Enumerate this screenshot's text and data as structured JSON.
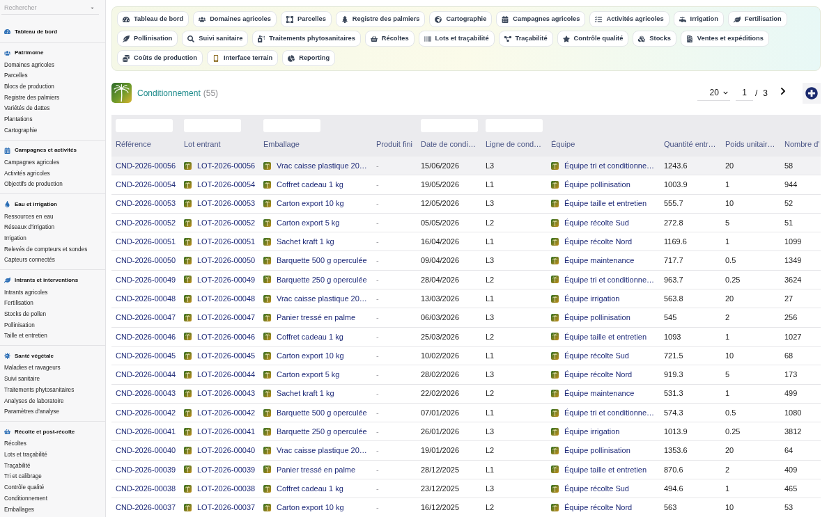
{
  "sidebar": {
    "search": {
      "placeholder": "Rechercher"
    },
    "sections": [
      {
        "title": "Tableau de bord"
      },
      {
        "title": "Patrimoine",
        "items": [
          "Domaines agricoles",
          "Parcelles",
          "Blocs de production",
          "Registre des palmiers",
          "Variétés de dattes",
          "Plantations",
          "Cartographie"
        ]
      },
      {
        "title": "Campagnes et activités",
        "items": [
          "Campagnes agricoles",
          "Activités agricoles",
          "Objectifs de production"
        ]
      },
      {
        "title": "Eau et irrigation",
        "items": [
          "Ressources en eau",
          "Réseaux d'irrigation",
          "Irrigation",
          "Relevés de compteurs et sondes",
          "Capteurs connectés"
        ]
      },
      {
        "title": "Intrants et interventions",
        "items": [
          "Intrants agricoles",
          "Fertilisation",
          "Stocks de pollen",
          "Pollinisation",
          "Taille et entretien"
        ]
      },
      {
        "title": "Santé végétale",
        "items": [
          "Maladies et ravageurs",
          "Suivi sanitaire",
          "Traitements phytosanitaires",
          "Analyses de laboratoire",
          "Paramètres d'analyse"
        ]
      },
      {
        "title": "Récolte et post-récolte",
        "items": [
          "Récoltes",
          "Lots et traçabilité",
          "Traçabilité",
          "Tri et calibrage",
          "Contrôle qualité",
          "Conditionnement",
          "Emballages"
        ]
      }
    ]
  },
  "tabs": [
    {
      "label": "Tableau de bord"
    },
    {
      "label": "Domaines agricoles"
    },
    {
      "label": "Parcelles"
    },
    {
      "label": "Registre des palmiers"
    },
    {
      "label": "Cartographie"
    },
    {
      "label": "Campagnes agricoles"
    },
    {
      "label": "Activités agricoles"
    },
    {
      "label": "Irrigation"
    },
    {
      "label": "Fertilisation"
    },
    {
      "label": "Pollinisation"
    },
    {
      "label": "Suivi sanitaire"
    },
    {
      "label": "Traitements phytosanitaires"
    },
    {
      "label": "Récoltes"
    },
    {
      "label": "Lots et traçabilité"
    },
    {
      "label": "Traçabilité"
    },
    {
      "label": "Contrôle qualité"
    },
    {
      "label": "Stocks"
    },
    {
      "label": "Ventes et expéditions"
    },
    {
      "label": "Coûts de production"
    },
    {
      "label": "Interface terrain"
    },
    {
      "label": "Reporting"
    }
  ],
  "page": {
    "title": "Conditionnement",
    "count": "(55)",
    "page_size": "20",
    "page": "1",
    "separator": "/",
    "total_pages": "3"
  },
  "table": {
    "columns": [
      {
        "label": "Référence",
        "kind": "link",
        "filter": true
      },
      {
        "label": "Lot entrant",
        "kind": "link_thumb",
        "filter": true
      },
      {
        "label": "Emballage",
        "kind": "link_thumb",
        "filter": true
      },
      {
        "label": "Produit fini",
        "kind": "muted",
        "filter": false
      },
      {
        "label": "Date de condi…",
        "kind": "text",
        "filter": true
      },
      {
        "label": "Ligne de cond…",
        "kind": "text",
        "filter": true
      },
      {
        "label": "Équipe",
        "kind": "link_thumb",
        "filter": false
      },
      {
        "label": "Quantité entr…",
        "kind": "text",
        "filter": false
      },
      {
        "label": "Poids unitair…",
        "kind": "text",
        "filter": false
      },
      {
        "label": "Nombre d'",
        "kind": "text",
        "filter": false
      }
    ],
    "rows": [
      {
        "highlighted": true,
        "cells": [
          "CND-2026-00056",
          "LOT-2026-00056",
          "Vrac caisse plastique 20…",
          "-",
          "15/06/2026",
          "L3",
          "Équipe tri et conditionne…",
          "1243.6",
          "20",
          "58"
        ]
      },
      {
        "highlighted": false,
        "cells": [
          "CND-2026-00054",
          "LOT-2026-00054",
          "Coffret cadeau 1 kg",
          "-",
          "19/05/2026",
          "L1",
          "Équipe pollinisation",
          "1003.9",
          "1",
          "944"
        ]
      },
      {
        "highlighted": false,
        "cells": [
          "CND-2026-00053",
          "LOT-2026-00053",
          "Carton export 10 kg",
          "-",
          "12/05/2026",
          "L3",
          "Équipe taille et entretien",
          "555.7",
          "10",
          "52"
        ]
      },
      {
        "highlighted": false,
        "cells": [
          "CND-2026-00052",
          "LOT-2026-00052",
          "Carton export 5 kg",
          "-",
          "05/05/2026",
          "L2",
          "Équipe récolte Sud",
          "272.8",
          "5",
          "51"
        ]
      },
      {
        "highlighted": false,
        "cells": [
          "CND-2026-00051",
          "LOT-2026-00051",
          "Sachet kraft 1 kg",
          "-",
          "16/04/2026",
          "L1",
          "Équipe récolte Nord",
          "1169.6",
          "1",
          "1099"
        ]
      },
      {
        "highlighted": false,
        "cells": [
          "CND-2026-00050",
          "LOT-2026-00050",
          "Barquette 500 g operculée",
          "-",
          "09/04/2026",
          "L3",
          "Équipe maintenance",
          "717.7",
          "0.5",
          "1349"
        ]
      },
      {
        "highlighted": false,
        "cells": [
          "CND-2026-00049",
          "LOT-2026-00049",
          "Barquette 250 g operculée",
          "-",
          "28/04/2026",
          "L2",
          "Équipe tri et conditionne…",
          "963.7",
          "0.25",
          "3624"
        ]
      },
      {
        "highlighted": false,
        "cells": [
          "CND-2026-00048",
          "LOT-2026-00048",
          "Vrac caisse plastique 20…",
          "-",
          "13/03/2026",
          "L1",
          "Équipe irrigation",
          "563.8",
          "20",
          "27"
        ]
      },
      {
        "highlighted": false,
        "cells": [
          "CND-2026-00047",
          "LOT-2026-00047",
          "Panier tressé en palme",
          "-",
          "06/03/2026",
          "L3",
          "Équipe pollinisation",
          "545",
          "2",
          "256"
        ]
      },
      {
        "highlighted": false,
        "cells": [
          "CND-2026-00046",
          "LOT-2026-00046",
          "Coffret cadeau 1 kg",
          "-",
          "25/03/2026",
          "L2",
          "Équipe taille et entretien",
          "1093",
          "1",
          "1027"
        ]
      },
      {
        "highlighted": false,
        "cells": [
          "CND-2026-00045",
          "LOT-2026-00045",
          "Carton export 10 kg",
          "-",
          "10/02/2026",
          "L1",
          "Équipe récolte Sud",
          "721.5",
          "10",
          "68"
        ]
      },
      {
        "highlighted": false,
        "cells": [
          "CND-2026-00044",
          "LOT-2026-00044",
          "Carton export 5 kg",
          "-",
          "28/02/2026",
          "L3",
          "Équipe récolte Nord",
          "919.3",
          "5",
          "173"
        ]
      },
      {
        "highlighted": false,
        "cells": [
          "CND-2026-00043",
          "LOT-2026-00043",
          "Sachet kraft 1 kg",
          "-",
          "22/02/2026",
          "L2",
          "Équipe maintenance",
          "531.3",
          "1",
          "499"
        ]
      },
      {
        "highlighted": false,
        "cells": [
          "CND-2026-00042",
          "LOT-2026-00042",
          "Barquette 500 g operculée",
          "-",
          "07/01/2026",
          "L1",
          "Équipe tri et conditionne…",
          "574.3",
          "0.5",
          "1080"
        ]
      },
      {
        "highlighted": false,
        "cells": [
          "CND-2026-00041",
          "LOT-2026-00041",
          "Barquette 250 g operculée",
          "-",
          "26/01/2026",
          "L3",
          "Équipe irrigation",
          "1013.9",
          "0.25",
          "3812"
        ]
      },
      {
        "highlighted": false,
        "cells": [
          "CND-2026-00040",
          "LOT-2026-00040",
          "Vrac caisse plastique 20…",
          "-",
          "19/01/2026",
          "L2",
          "Équipe pollinisation",
          "1353.6",
          "20",
          "64"
        ]
      },
      {
        "highlighted": false,
        "cells": [
          "CND-2026-00039",
          "LOT-2026-00039",
          "Panier tressé en palme",
          "-",
          "28/12/2025",
          "L1",
          "Équipe taille et entretien",
          "870.6",
          "2",
          "409"
        ]
      },
      {
        "highlighted": false,
        "cells": [
          "CND-2026-00038",
          "LOT-2026-00038",
          "Coffret cadeau 1 kg",
          "-",
          "23/12/2025",
          "L3",
          "Équipe récolte Sud",
          "494.6",
          "1",
          "465"
        ]
      },
      {
        "highlighted": false,
        "cells": [
          "CND-2026-00037",
          "LOT-2026-00037",
          "Carton export 10 kg",
          "-",
          "16/12/2025",
          "L2",
          "Équipe récolte Nord",
          "563",
          "10",
          "53"
        ]
      }
    ]
  }
}
